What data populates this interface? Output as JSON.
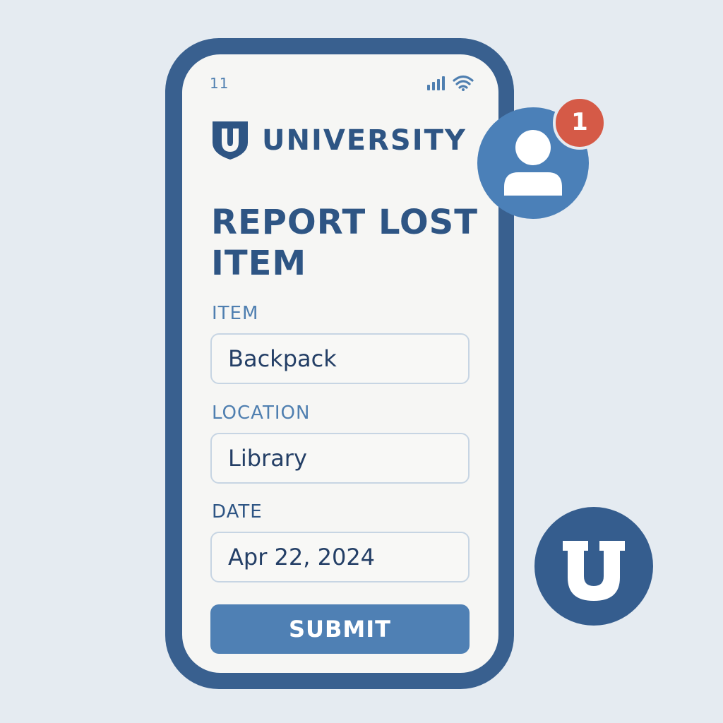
{
  "status_bar": {
    "time": "11",
    "signal_icon": "signal-bars-icon",
    "wifi_icon": "wifi-icon"
  },
  "brand": {
    "logo_icon": "university-shield-icon",
    "name": "UNIVERSITY"
  },
  "form": {
    "title": "REPORT LOST ITEM",
    "fields": [
      {
        "label": "ITEM",
        "value": "Backpack"
      },
      {
        "label": "LOCATION",
        "value": "Library"
      },
      {
        "label": "DATE",
        "value": "Apr 22, 2024"
      }
    ],
    "submit_label": "SUBMIT"
  },
  "profile": {
    "icon": "user-icon",
    "notification_count": "1"
  },
  "floating_logo": {
    "icon": "university-u-logo-icon"
  },
  "colors": {
    "background": "#e5ebf1",
    "phone_frame": "#39608f",
    "screen": "#f6f6f4",
    "primary_text": "#2e5584",
    "label_text": "#4f7fb0",
    "accent_button": "#4f80b4",
    "badge": "#d55a47",
    "input_border": "#c7d5e3"
  }
}
